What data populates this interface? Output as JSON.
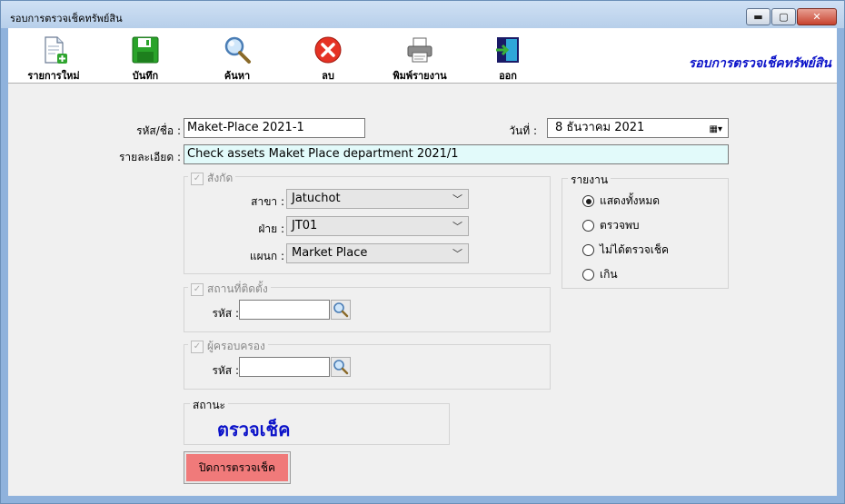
{
  "window": {
    "title": "รอบการตรวจเช็คทรัพย์สิน",
    "minimize_glyph": "▬",
    "maximize_glyph": "▢",
    "close_glyph": "✕"
  },
  "toolbar": {
    "buttons": [
      {
        "label": "รายการใหม่",
        "icon": "new-document-icon"
      },
      {
        "label": "บันทึก",
        "icon": "save-disk-icon"
      },
      {
        "label": "ค้นหา",
        "icon": "magnifier-icon"
      },
      {
        "label": "ลบ",
        "icon": "delete-icon"
      },
      {
        "label": "พิมพ์รายงาน",
        "icon": "printer-icon"
      },
      {
        "label": "ออก",
        "icon": "exit-door-icon"
      }
    ],
    "title": "รอบการตรวจเช็คทรัพย์สิน"
  },
  "form": {
    "code_label": "รหัส/ชื่อ :",
    "code_value": "Maket-Place 2021-1",
    "date_label": "วันที่ :",
    "date_value": "8   ธันวาคม   2021",
    "detail_label": "รายละเอียด :",
    "detail_value": "Check assets Maket Place department 2021/1"
  },
  "affiliation": {
    "legend": "สังกัด",
    "branch_label": "สาขา :",
    "branch_value": "Jatuchot",
    "division_label": "ฝ่าย :",
    "division_value": "JT01",
    "department_label": "แผนก :",
    "department_value": "Market Place"
  },
  "location": {
    "legend": "สถานที่ติดตั้ง",
    "code_label": "รหัส :",
    "code_value": ""
  },
  "custodian": {
    "legend": "ผู้ครอบครอง",
    "code_label": "รหัส :",
    "code_value": ""
  },
  "report": {
    "legend": "รายงาน",
    "options": [
      {
        "label": "แสดงทั้งหมด",
        "selected": true
      },
      {
        "label": "ตรวจพบ",
        "selected": false
      },
      {
        "label": "ไม่ได้ตรวจเช็ค",
        "selected": false
      },
      {
        "label": "เกิน",
        "selected": false
      }
    ]
  },
  "status": {
    "legend": "สถานะ",
    "value": "ตรวจเช็ค"
  },
  "actions": {
    "close_check_label": "ปิดการตรวจเช็ค"
  },
  "colors": {
    "accent_title": "#0b12c9",
    "close_button_bg": "#f07a7a",
    "detail_field_bg": "#e2fafa"
  }
}
